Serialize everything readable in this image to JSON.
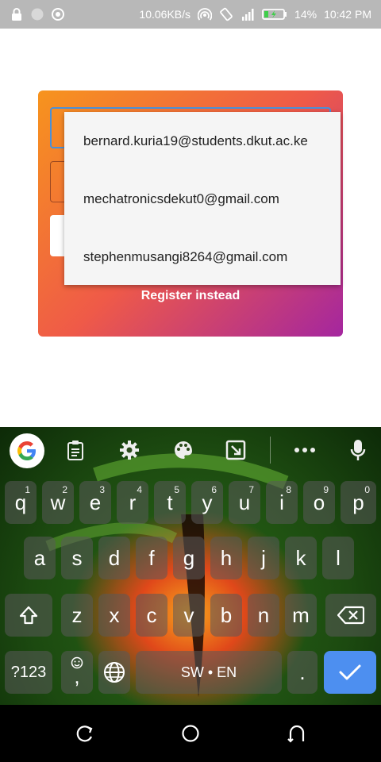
{
  "status_bar": {
    "speed": "10.06KB/s",
    "battery": "14%",
    "time": "10:42 PM"
  },
  "login": {
    "register_link": "Register instead"
  },
  "autofill": {
    "items": [
      "bernard.kuria19@students.dkut.ac.ke",
      "mechatronicsdekut0@gmail.com",
      "stephenmusangi8264@gmail.com"
    ]
  },
  "keyboard": {
    "row1": [
      {
        "key": "q",
        "hint": "1"
      },
      {
        "key": "w",
        "hint": "2"
      },
      {
        "key": "e",
        "hint": "3"
      },
      {
        "key": "r",
        "hint": "4"
      },
      {
        "key": "t",
        "hint": "5"
      },
      {
        "key": "y",
        "hint": "6"
      },
      {
        "key": "u",
        "hint": "7"
      },
      {
        "key": "i",
        "hint": "8"
      },
      {
        "key": "o",
        "hint": "9"
      },
      {
        "key": "p",
        "hint": "0"
      }
    ],
    "row2": [
      "a",
      "s",
      "d",
      "f",
      "g",
      "h",
      "j",
      "k",
      "l"
    ],
    "row3": [
      "z",
      "x",
      "c",
      "v",
      "b",
      "n",
      "m"
    ],
    "symbols_label": "?123",
    "comma": ",",
    "space_label": "SW • EN",
    "period": "."
  },
  "colors": {
    "card_gradient_start": "#f7941d",
    "card_gradient_end": "#a4269f",
    "enter_key": "#4d8ff0",
    "focus_border": "#4a90d9"
  },
  "icons": [
    "lock-icon",
    "circle-icon",
    "record-icon",
    "hotspot-icon",
    "rotate-icon",
    "signal-icon",
    "battery-icon",
    "google-icon",
    "clipboard-icon",
    "gear-icon",
    "palette-icon",
    "screen-icon",
    "more-icon",
    "mic-icon",
    "shift-icon",
    "backspace-icon",
    "emoji-icon",
    "globe-icon",
    "check-icon",
    "recent-icon",
    "home-icon",
    "back-icon"
  ]
}
